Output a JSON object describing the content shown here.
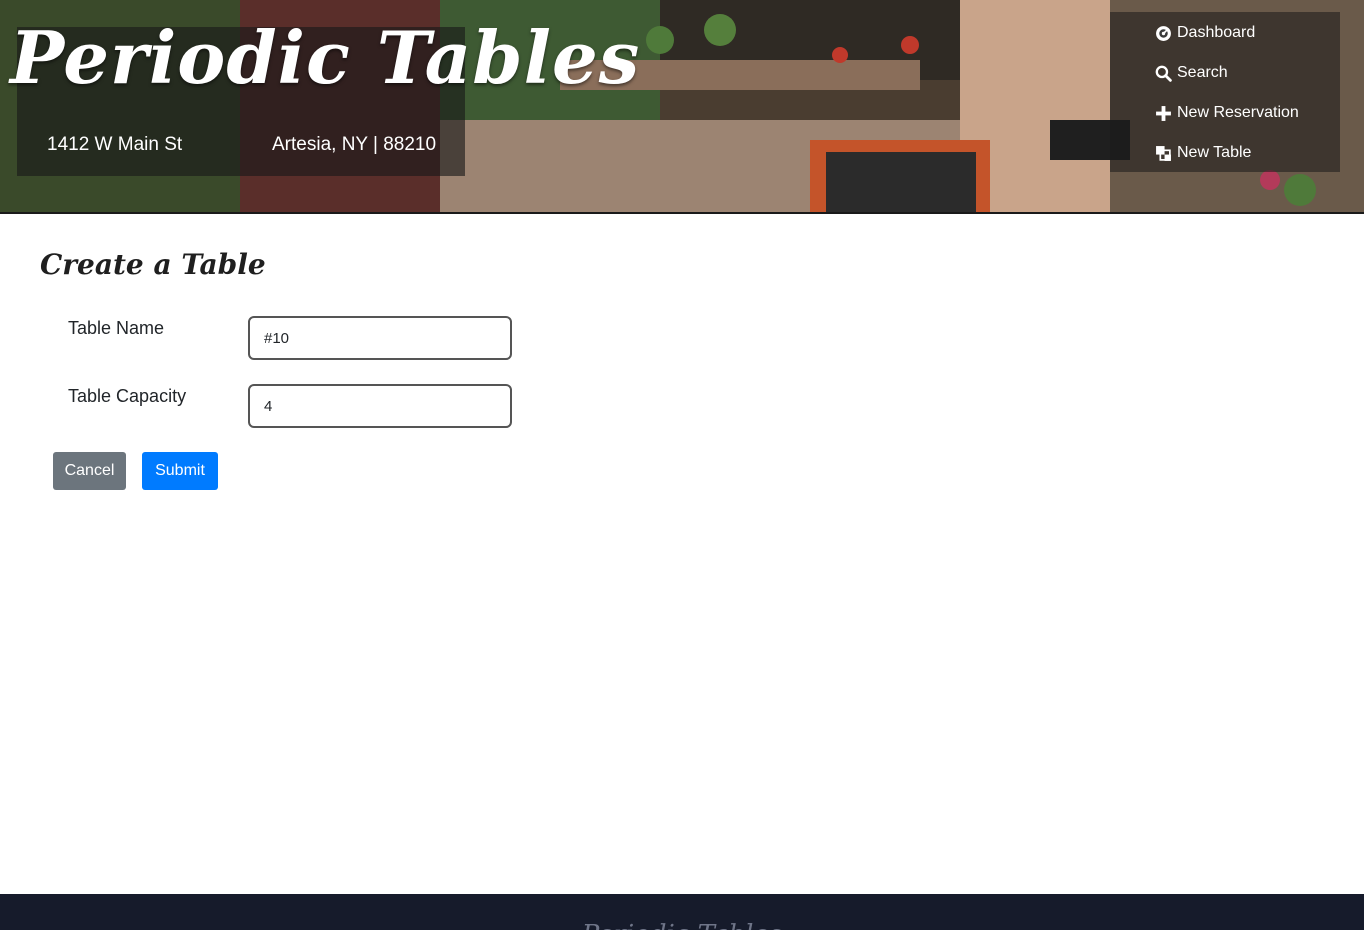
{
  "header": {
    "brand_title": "Periodic Tables",
    "address_street": "1412 W Main St",
    "address_city": "Artesia, NY | 88210"
  },
  "nav": {
    "items": [
      {
        "label": "Dashboard",
        "icon": "dashboard-icon"
      },
      {
        "label": "Search",
        "icon": "search-icon"
      },
      {
        "label": "New Reservation",
        "icon": "plus-icon"
      },
      {
        "label": "New Table",
        "icon": "layers-icon"
      }
    ]
  },
  "main": {
    "title": "Create a Table",
    "fields": {
      "table_name": {
        "label": "Table Name",
        "value": "#10"
      },
      "table_capacity": {
        "label": "Table Capacity",
        "value": "4"
      }
    },
    "buttons": {
      "cancel": "Cancel",
      "submit": "Submit"
    }
  },
  "footer": {
    "text": "Periodic Tables"
  },
  "colors": {
    "primary": "#007bff",
    "secondary": "#6c757d",
    "footer_bg": "#161b2b"
  }
}
